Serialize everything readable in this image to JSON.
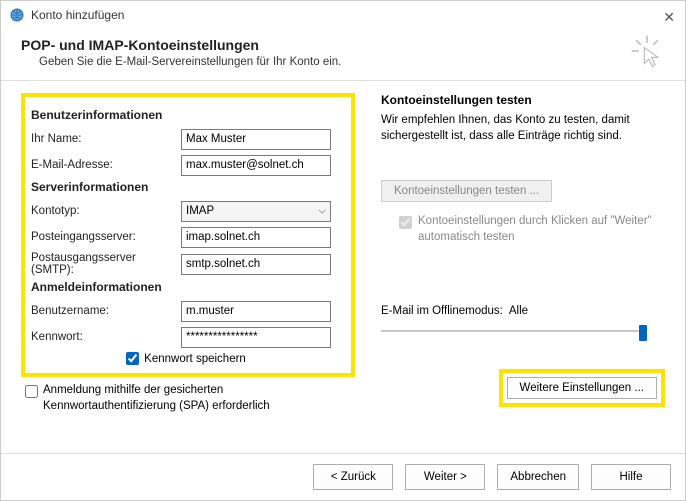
{
  "window": {
    "title": "Konto hinzufügen"
  },
  "header": {
    "title": "POP- und IMAP-Kontoeinstellungen",
    "subtitle": "Geben Sie die E-Mail-Servereinstellungen für Ihr Konto ein."
  },
  "left": {
    "userinfo_title": "Benutzerinformationen",
    "name_label": "Ihr Name:",
    "name_value": "Max Muster",
    "email_label": "E-Mail-Adresse:",
    "email_value": "max.muster@solnet.ch",
    "serverinfo_title": "Serverinformationen",
    "type_label": "Kontotyp:",
    "type_value": "IMAP",
    "incoming_label": "Posteingangsserver:",
    "incoming_value": "imap.solnet.ch",
    "outgoing_label": "Postausgangsserver (SMTP):",
    "outgoing_value": "smtp.solnet.ch",
    "logininfo_title": "Anmeldeinformationen",
    "user_label": "Benutzername:",
    "user_value": "m.muster",
    "pass_label": "Kennwort:",
    "pass_value": "****************",
    "save_pw_label": "Kennwort speichern",
    "spa_label": "Anmeldung mithilfe der gesicherten Kennwortauthentifizierung (SPA) erforderlich"
  },
  "right": {
    "test_title": "Kontoeinstellungen testen",
    "test_desc": "Wir empfehlen Ihnen, das Konto zu testen, damit sichergestellt ist, dass alle Einträge richtig sind.",
    "test_btn": "Kontoeinstellungen testen ...",
    "auto_test_label": "Kontoeinstellungen durch Klicken auf \"Weiter\" automatisch testen",
    "offline_label": "E-Mail im Offlinemodus:",
    "offline_value": "Alle",
    "more_btn": "Weitere Einstellungen ..."
  },
  "footer": {
    "back": "< Zurück",
    "next": "Weiter >",
    "cancel": "Abbrechen",
    "help": "Hilfe"
  }
}
